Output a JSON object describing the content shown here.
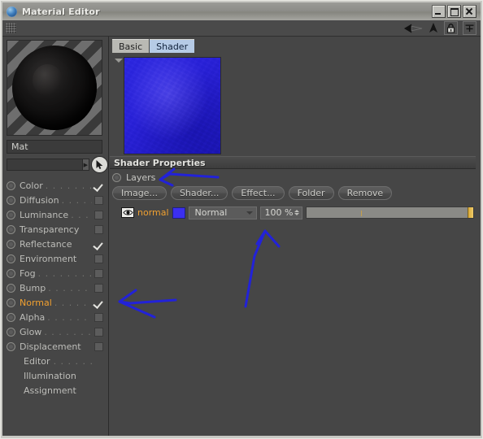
{
  "window": {
    "title": "Material Editor",
    "icon": "app-sphere-icon",
    "buttons": {
      "minimize": "_",
      "maximize": "□",
      "close": "×"
    }
  },
  "toolbar": {
    "grip": "drag-grip",
    "icons": [
      "back-arrow-icon",
      "up-arrow-icon",
      "lock-icon",
      "plus-icon"
    ]
  },
  "left_pane": {
    "preview": "material-sphere-preview",
    "material_name": "Mat",
    "material_name_placeholder": "",
    "link_field_value": "",
    "link_field_placeholder": "",
    "channels": [
      {
        "label": "Color",
        "dots": ". . . . . . . .",
        "checked": true,
        "selected": false
      },
      {
        "label": "Diffusion",
        "dots": ". . . . .",
        "checked": false,
        "selected": false
      },
      {
        "label": "Luminance",
        "dots": ". . .",
        "checked": false,
        "selected": false
      },
      {
        "label": "Transparency",
        "dots": "",
        "checked": false,
        "selected": false
      },
      {
        "label": "Reflectance",
        "dots": "",
        "checked": true,
        "selected": false
      },
      {
        "label": "Environment",
        "dots": "",
        "checked": false,
        "selected": false
      },
      {
        "label": "Fog",
        "dots": ". . . . . . . .",
        "checked": false,
        "selected": false
      },
      {
        "label": "Bump",
        "dots": ". . . . . . .",
        "checked": false,
        "selected": false
      },
      {
        "label": "Normal",
        "dots": ". . . . . . .",
        "checked": true,
        "selected": true
      },
      {
        "label": "Alpha",
        "dots": ". . . . . . .",
        "checked": false,
        "selected": false
      },
      {
        "label": "Glow",
        "dots": ". . . . . . .",
        "checked": false,
        "selected": false
      },
      {
        "label": "Displacement",
        "dots": "",
        "checked": false,
        "selected": false
      }
    ],
    "sub_items": [
      {
        "label": "Editor",
        "dots": ". . . . . ."
      },
      {
        "label": "Illumination",
        "dots": ""
      },
      {
        "label": "Assignment",
        "dots": ""
      }
    ]
  },
  "right_pane": {
    "tabs": [
      {
        "label": "Basic",
        "active": false
      },
      {
        "label": "Shader",
        "active": true
      }
    ],
    "thumbnail": "shader-preview-thumbnail",
    "section_title": "Shader Properties",
    "layers_label": "Layers",
    "buttons": [
      {
        "label": "Image..."
      },
      {
        "label": "Shader..."
      },
      {
        "label": "Effect..."
      },
      {
        "label": "Folder"
      },
      {
        "label": "Remove"
      }
    ],
    "layer": {
      "visibility": "eye-icon",
      "name": "normal",
      "color_swatch": "#3b2ff0",
      "blend_mode": "Normal",
      "opacity_value": "100 %",
      "opacity_percent": 100
    }
  },
  "annotations": {
    "arrow_layers": "blue-arrow-pointing-to-layers",
    "arrow_opacity": "blue-arrow-pointing-to-opacity-field",
    "arrow_normal_channel": "blue-arrow-pointing-to-normal-channel"
  },
  "colors": {
    "accent_orange": "#f0a030",
    "tab_active": "#b6cbe6",
    "annotation_blue": "#2222d8",
    "panel_bg": "#464646",
    "layer_swatch": "#3b2ff0"
  }
}
